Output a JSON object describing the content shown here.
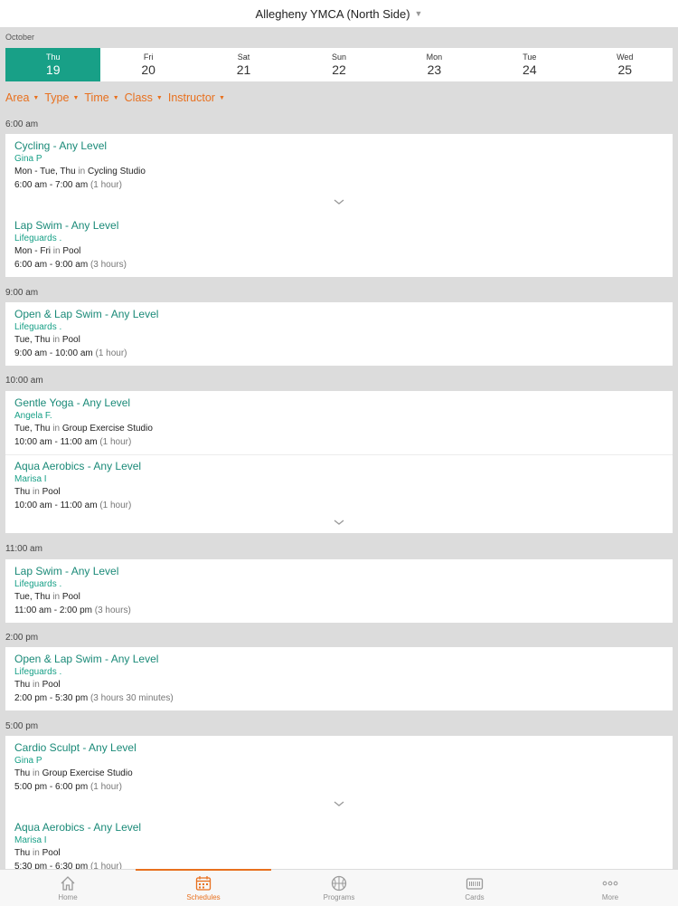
{
  "header": {
    "title": "Allegheny YMCA (North Side)"
  },
  "calendar": {
    "month": "October",
    "days": [
      {
        "name": "Thu",
        "num": "19"
      },
      {
        "name": "Fri",
        "num": "20"
      },
      {
        "name": "Sat",
        "num": "21"
      },
      {
        "name": "Sun",
        "num": "22"
      },
      {
        "name": "Mon",
        "num": "23"
      },
      {
        "name": "Tue",
        "num": "24"
      },
      {
        "name": "Wed",
        "num": "25"
      }
    ]
  },
  "filters": [
    "Area",
    "Type",
    "Time",
    "Class",
    "Instructor"
  ],
  "groups": [
    {
      "time": "6:00 am",
      "classes": [
        {
          "title": "Cycling - Any Level",
          "instructor": "Gina P",
          "days": "Mon - Tue, Thu",
          "in": "in",
          "location": "Cycling Studio",
          "time": "6:00 am - 7:00 am",
          "duration": "(1 hour)"
        },
        {
          "title": "Lap Swim - Any Level",
          "instructor": "Lifeguards .",
          "days": "Mon - Fri",
          "in": "in",
          "location": "Pool",
          "time": "6:00 am - 9:00 am",
          "duration": "(3 hours)"
        }
      ]
    },
    {
      "time": "9:00 am",
      "classes": [
        {
          "title": "Open & Lap Swim - Any Level",
          "instructor": "Lifeguards .",
          "days": "Tue, Thu",
          "in": "in",
          "location": "Pool",
          "time": "9:00 am - 10:00 am",
          "duration": "(1 hour)"
        }
      ]
    },
    {
      "time": "10:00 am",
      "classes": [
        {
          "title": "Gentle Yoga - Any Level",
          "instructor": "Angela F.",
          "days": "Tue, Thu",
          "in": "in",
          "location": "Group Exercise Studio",
          "time": "10:00 am - 11:00 am",
          "duration": "(1 hour)"
        },
        {
          "title": "Aqua Aerobics - Any Level",
          "instructor": "Marisa I",
          "days": "Thu",
          "in": "in",
          "location": "Pool",
          "time": "10:00 am - 11:00 am",
          "duration": "(1 hour)"
        }
      ]
    },
    {
      "time": "11:00 am",
      "classes": [
        {
          "title": "Lap Swim - Any Level",
          "instructor": "Lifeguards .",
          "days": "Tue, Thu",
          "in": "in",
          "location": "Pool",
          "time": "11:00 am - 2:00 pm",
          "duration": "(3 hours)"
        }
      ]
    },
    {
      "time": "2:00 pm",
      "classes": [
        {
          "title": "Open & Lap Swim - Any Level",
          "instructor": "Lifeguards .",
          "days": "Thu",
          "in": "in",
          "location": "Pool",
          "time": "2:00 pm - 5:30 pm",
          "duration": "(3 hours 30 minutes)"
        }
      ]
    },
    {
      "time": "5:00 pm",
      "classes": [
        {
          "title": "Cardio Sculpt - Any Level",
          "instructor": "Gina P",
          "days": "Thu",
          "in": "in",
          "location": "Group Exercise Studio",
          "time": "5:00 pm - 6:00 pm",
          "duration": "(1 hour)"
        },
        {
          "title": "Aqua Aerobics - Any Level",
          "instructor": "Marisa I",
          "days": "Thu",
          "in": "in",
          "location": "Pool",
          "time": "5:30 pm - 6:30 pm",
          "duration": "(1 hour)"
        }
      ]
    }
  ],
  "tabs": [
    {
      "label": "Home",
      "icon": "home-icon"
    },
    {
      "label": "Schedules",
      "icon": "calendar-icon"
    },
    {
      "label": "Programs",
      "icon": "basketball-icon"
    },
    {
      "label": "Cards",
      "icon": "card-icon"
    },
    {
      "label": "More",
      "icon": "more-icon"
    }
  ],
  "colors": {
    "accent": "#e8701e",
    "teal": "#18a087"
  }
}
